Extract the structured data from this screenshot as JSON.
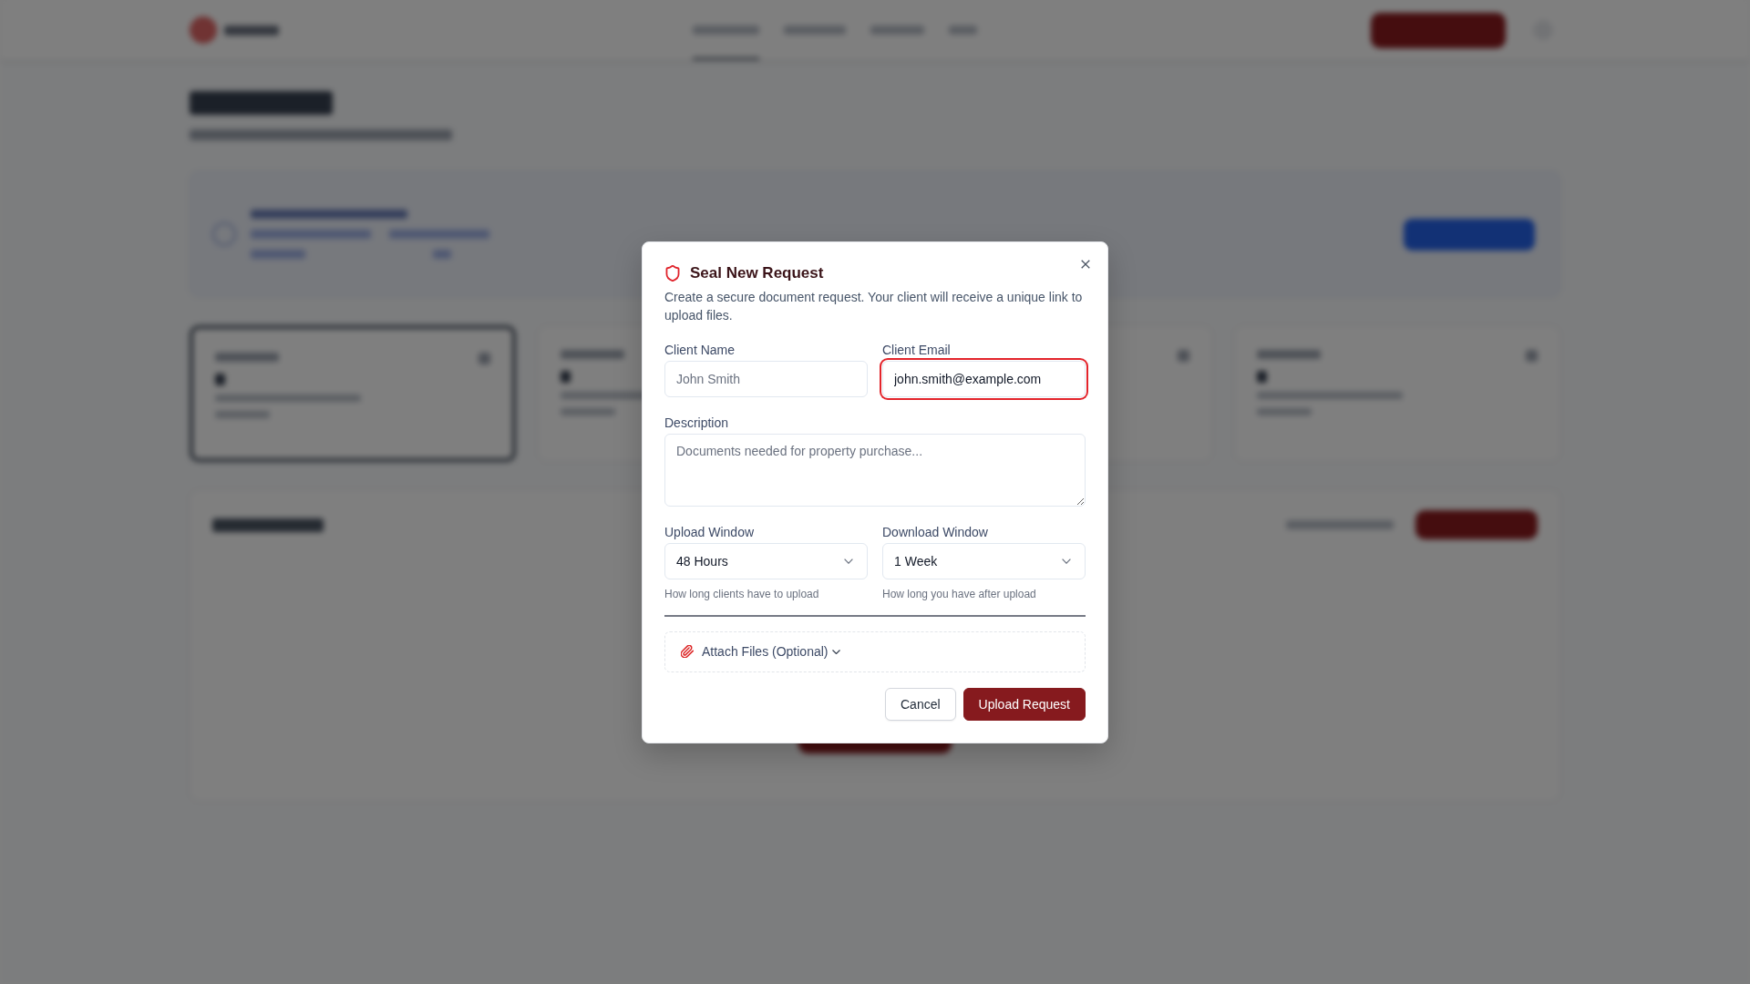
{
  "dialog": {
    "title": "Seal New Request",
    "description": "Create a secure document request. Your client will receive a unique link to upload files.",
    "fields": [
      {
        "kind": "input",
        "label": "Client Name",
        "placeholder": "John Smith",
        "focused": false
      },
      {
        "kind": "input",
        "label": "Client Email",
        "value": "john.smith@example.com",
        "focused": true
      },
      {
        "kind": "textarea",
        "label": "Description",
        "placeholder": "Documents needed for property purchase...",
        "focused": false
      },
      {
        "kind": "select",
        "label": "Upload Window",
        "value": "48 Hours",
        "hint": "How long clients have to upload",
        "focused": false
      },
      {
        "kind": "select",
        "label": "Download Window",
        "value": "1 Week",
        "hint": "How long you have after upload",
        "focused": false
      }
    ],
    "attachments": {
      "label": "Attach Files (Optional)",
      "expanded": false
    },
    "buttons": [
      {
        "kind": "secondary",
        "label": "Cancel"
      },
      {
        "kind": "primary",
        "label": "Upload Request"
      }
    ]
  }
}
